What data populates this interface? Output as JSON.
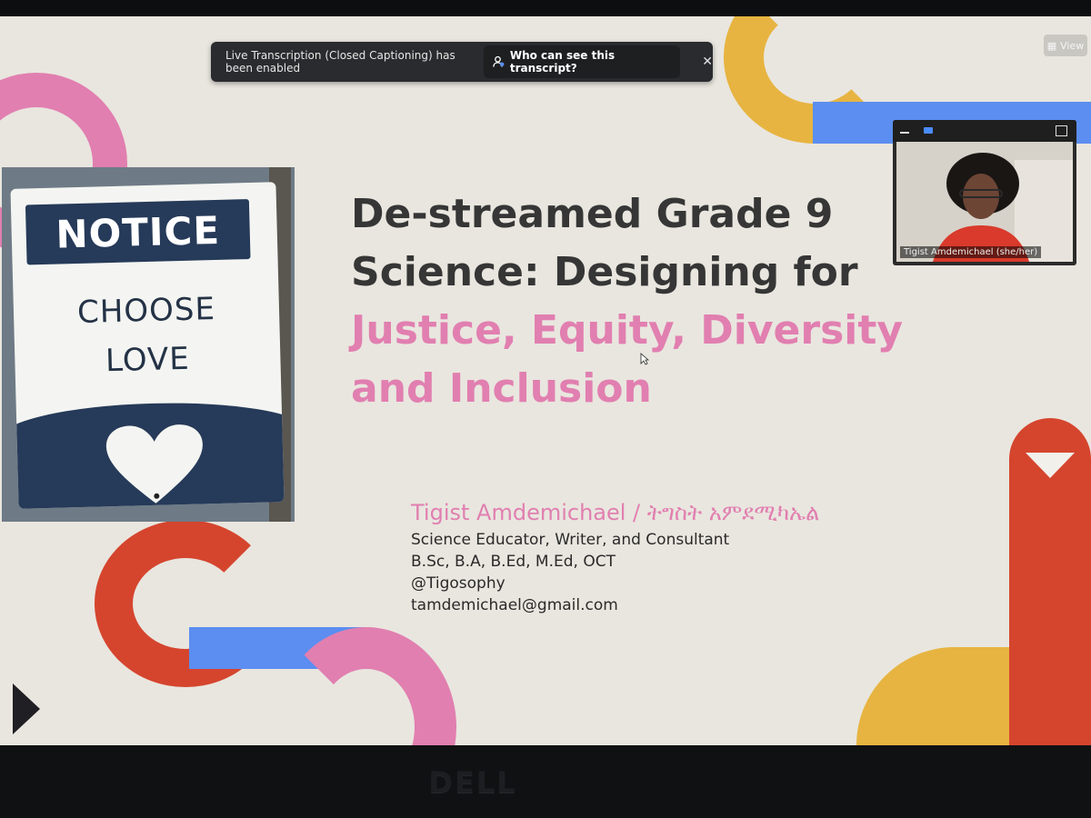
{
  "notification": {
    "message": "Live Transcription (Closed Captioning) has been enabled",
    "button_label": "Who can see this transcript?",
    "close_icon": "close-icon"
  },
  "view_button": {
    "label": "View"
  },
  "photo_sign": {
    "header": "NOTICE",
    "line1": "CHOOSE",
    "line2": "LOVE"
  },
  "slide": {
    "title_line1": "De-streamed Grade 9",
    "title_line2": "Science: Designing for",
    "title_line3": "Justice, Equity, Diversity",
    "title_line4": "and Inclusion",
    "author": "Tigist Amdemichael / ትግስት  አምደሚካኤል",
    "role": "Science Educator, Writer, and Consultant",
    "degrees": "B.Sc, B.A, B.Ed, M.Ed, OCT",
    "handle": "@Tigosophy",
    "email": "tamdemichael@gmail.com"
  },
  "participant": {
    "name": "Tigist Amdemichael (she/her)"
  },
  "monitor": {
    "brand": "DELL"
  },
  "colors": {
    "pink": "#e17fb0",
    "yellow": "#e7b441",
    "blue": "#5b8ef0",
    "red": "#d5452e",
    "navy": "#263a59"
  }
}
